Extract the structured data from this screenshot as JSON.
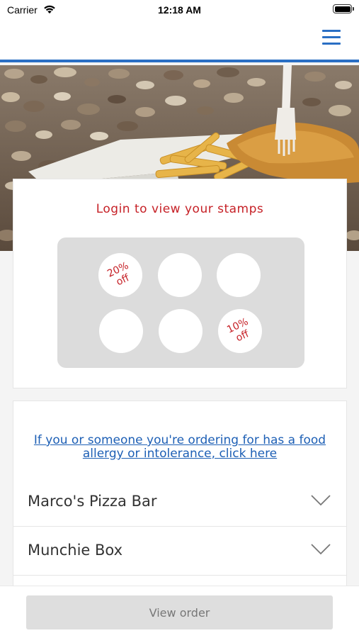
{
  "status_bar": {
    "carrier": "Carrier",
    "time": "12:18 AM"
  },
  "header": {
    "menu_icon": "hamburger-menu-icon",
    "accent_color": "#2a6fc4"
  },
  "hero": {
    "image": "fish-and-chips-on-pebble-beach"
  },
  "stamps": {
    "login_text": "Login to view your stamps",
    "login_color": "#c62127",
    "items": [
      {
        "label_line1": "20%",
        "label_line2": "off"
      },
      {
        "label_line1": "",
        "label_line2": ""
      },
      {
        "label_line1": "",
        "label_line2": ""
      },
      {
        "label_line1": "",
        "label_line2": ""
      },
      {
        "label_line1": "",
        "label_line2": ""
      },
      {
        "label_line1": "10%",
        "label_line2": "off"
      }
    ]
  },
  "allergy": {
    "link_line1": "If you or someone you're ordering for has a food",
    "link_line2": "allergy or intolerance, click here"
  },
  "restaurants": [
    {
      "name": "Marco's Pizza Bar",
      "icon": "chevron-down-icon"
    },
    {
      "name": "Munchie Box",
      "icon": "chevron-down-icon"
    }
  ],
  "footer": {
    "view_order_label": "View order"
  }
}
